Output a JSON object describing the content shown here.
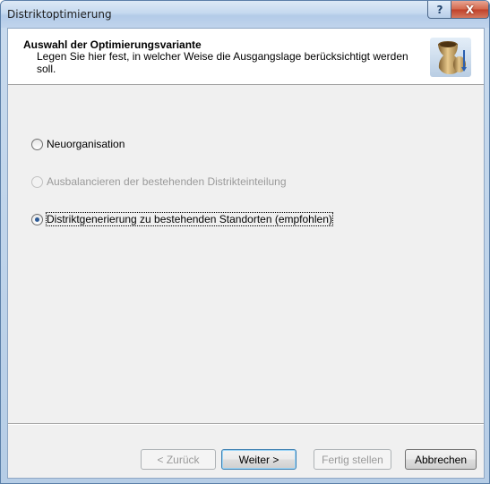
{
  "window": {
    "title": "Distriktoptimierung",
    "help_glyph": "?",
    "close_glyph": "X"
  },
  "header": {
    "title": "Auswahl der Optimierungsvariante",
    "description": "Legen Sie hier fest, in welcher Weise die Ausgangslage berücksichtigt werden soll.",
    "icon": "wizard-vase-icon"
  },
  "options": [
    {
      "label": "Neuorganisation",
      "checked": false,
      "enabled": true
    },
    {
      "label": "Ausbalancieren der bestehenden Distrikteinteilung",
      "checked": false,
      "enabled": false
    },
    {
      "label": "Distriktgenerierung zu bestehenden Standorten (empfohlen)",
      "checked": true,
      "enabled": true
    }
  ],
  "buttons": {
    "back": "< Zurück",
    "next": "Weiter >",
    "finish": "Fertig stellen",
    "cancel": "Abbrechen"
  }
}
